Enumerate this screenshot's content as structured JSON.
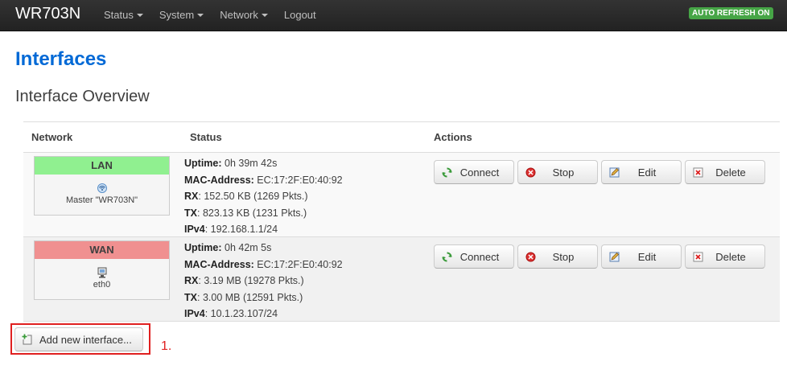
{
  "navbar": {
    "brand": "WR703N",
    "menu": [
      {
        "label": "Status",
        "dropdown": true
      },
      {
        "label": "System",
        "dropdown": true
      },
      {
        "label": "Network",
        "dropdown": true
      },
      {
        "label": "Logout",
        "dropdown": false
      }
    ],
    "auto_refresh": "AUTO REFRESH ON"
  },
  "page_title": "Interfaces",
  "section_title": "Interface Overview",
  "table": {
    "headers": {
      "network": "Network",
      "status": "Status",
      "actions": "Actions"
    },
    "rows": [
      {
        "name": "LAN",
        "name_color": "#90f090",
        "icon": "wifi-icon",
        "device": "Master \"WR703N\"",
        "status": {
          "uptime_label": "Uptime:",
          "uptime": "0h 39m 42s",
          "mac_label": "MAC-Address:",
          "mac": "EC:17:2F:E0:40:92",
          "rx_label": "RX",
          "rx": "152.50 KB (1269 Pkts.)",
          "tx_label": "TX",
          "tx": "823.13 KB (1231 Pkts.)",
          "ipv4_label": "IPv4",
          "ipv4": "192.168.1.1/24"
        }
      },
      {
        "name": "WAN",
        "name_color": "#f09090",
        "icon": "ethernet-icon",
        "device": "eth0",
        "status": {
          "uptime_label": "Uptime:",
          "uptime": "0h 42m 5s",
          "mac_label": "MAC-Address:",
          "mac": "EC:17:2F:E0:40:92",
          "rx_label": "RX",
          "rx": "3.19 MB (19278 Pkts.)",
          "tx_label": "TX",
          "tx": "3.00 MB (12591 Pkts.)",
          "ipv4_label": "IPv4",
          "ipv4": "10.1.23.107/24"
        }
      }
    ],
    "actions": {
      "connect": "Connect",
      "stop": "Stop",
      "edit": "Edit",
      "delete": "Delete"
    }
  },
  "add_button": "Add new interface...",
  "annotation": "1.",
  "colors": {
    "accent": "#0069d6",
    "navbar": "#222222",
    "badge": "#46a546",
    "highlight": "#e02020"
  }
}
